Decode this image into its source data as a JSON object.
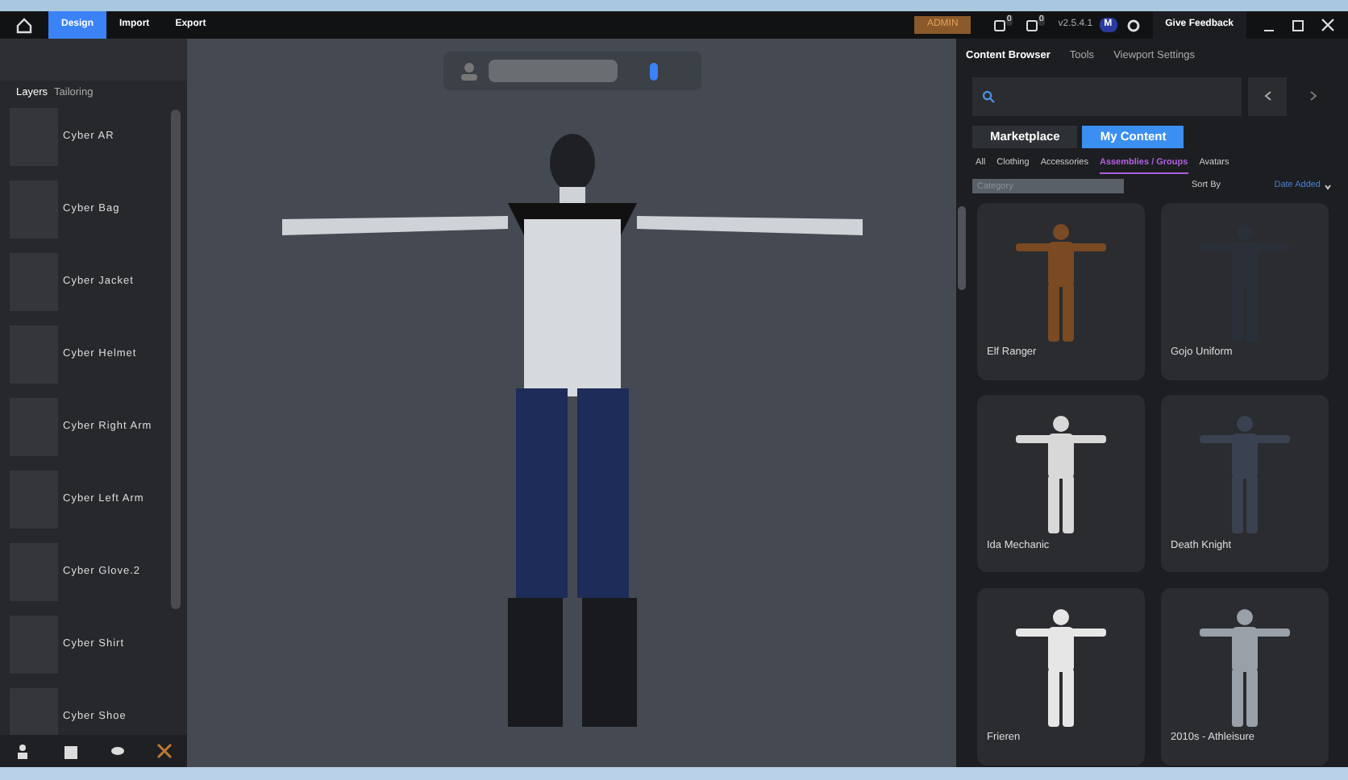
{
  "menu": [
    {
      "label": "Design",
      "selected": true
    },
    {
      "label": "Import",
      "selected": false
    },
    {
      "label": "Export",
      "selected": false
    }
  ],
  "admin_badge": "ADMIN",
  "notifications": [
    {
      "count": "0"
    },
    {
      "count": "0"
    }
  ],
  "version": "v2.5.4.1",
  "user_initial": "M",
  "feedback_button": "Give Feedback",
  "left_panel": {
    "tabs": [
      {
        "label": "Layers",
        "selected": true
      },
      {
        "label": "Tailoring",
        "selected": false
      }
    ],
    "items": [
      {
        "name": "Cyber AR"
      },
      {
        "name": "Cyber Bag"
      },
      {
        "name": "Cyber Jacket"
      },
      {
        "name": "Cyber Helmet"
      },
      {
        "name": "Cyber Right Arm"
      },
      {
        "name": "Cyber Left Arm"
      },
      {
        "name": "Cyber Glove.2"
      },
      {
        "name": "Cyber Shirt"
      },
      {
        "name": "Cyber Shoe"
      }
    ]
  },
  "right_panel": {
    "tabs": [
      {
        "label": "Content Browser",
        "selected": true
      },
      {
        "label": "Tools",
        "selected": false
      },
      {
        "label": "Viewport Settings",
        "selected": false
      }
    ],
    "source_tabs": [
      {
        "label": "Marketplace",
        "selected": false
      },
      {
        "label": "My Content",
        "selected": true
      }
    ],
    "categories": [
      {
        "label": "All",
        "selected": false
      },
      {
        "label": "Clothing",
        "selected": false
      },
      {
        "label": "Accessories",
        "selected": false
      },
      {
        "label": "Assemblies / Groups",
        "selected": true
      },
      {
        "label": "Avatars",
        "selected": false
      }
    ],
    "category_select": {
      "placeholder": "Category"
    },
    "sort_label": "Sort By",
    "sort_value": "Date Added",
    "cards": [
      {
        "name": "Elf Ranger"
      },
      {
        "name": "Gojo Uniform"
      },
      {
        "name": "Ida Mechanic"
      },
      {
        "name": "Death Knight"
      },
      {
        "name": "Frieren"
      },
      {
        "name": "2010s - Athleisure"
      }
    ]
  }
}
